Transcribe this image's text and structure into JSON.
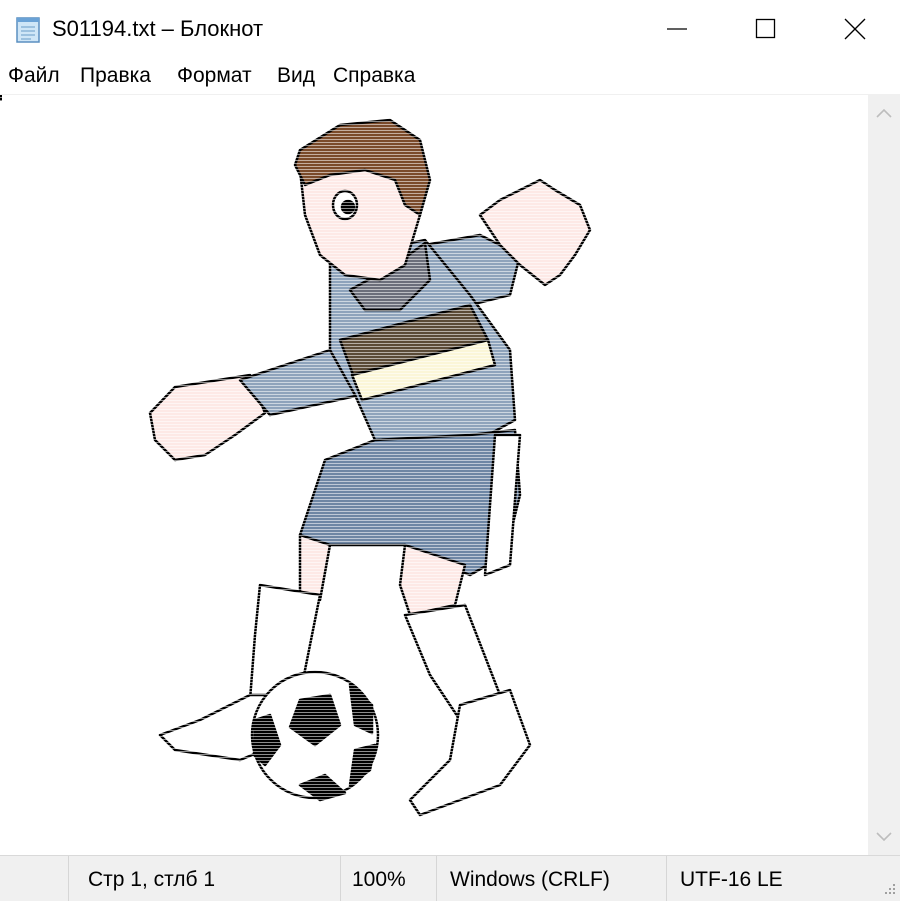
{
  "window": {
    "title": "S01194.txt – Блокнот",
    "icon": "notepad-icon",
    "controls": [
      "minimize-icon",
      "maximize-icon",
      "close-icon"
    ]
  },
  "menu": {
    "items": [
      {
        "label": "Файл"
      },
      {
        "label": "Правка"
      },
      {
        "label": "Формат"
      },
      {
        "label": "Вид"
      },
      {
        "label": "Справка"
      }
    ]
  },
  "editor": {
    "content_description_icon": "ascii-art-soccer-player"
  },
  "status": {
    "position": "Стр 1, стлб 1",
    "zoom": "100%",
    "line_endings": "Windows (CRLF)",
    "encoding": "UTF-16 LE"
  },
  "colors": {
    "shirt": "#8ea3bb",
    "hair": "#7a4a2a",
    "skin": "#fde9e6",
    "stripe_dark": "#5a4a36",
    "stripe_light": "#fbf6d8",
    "shorts": "#6e86a4",
    "statusbar_bg": "#f0f0f0"
  }
}
